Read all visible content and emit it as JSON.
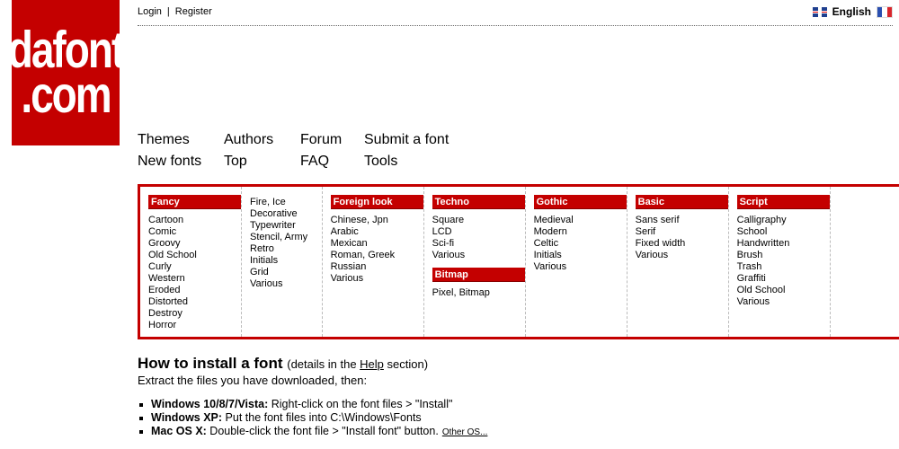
{
  "logo": {
    "line1": "dafont",
    "line2": ".com"
  },
  "topbar": {
    "login": "Login",
    "separator": "|",
    "register": "Register",
    "language": "English",
    "colors": {
      "french_blue": "#2a4fb0",
      "french_white": "#ffffff",
      "french_red": "#d8262b"
    }
  },
  "nav": {
    "col1": [
      "Themes",
      "New fonts"
    ],
    "col2": [
      "Authors",
      "Top"
    ],
    "col3": [
      "Forum",
      "FAQ"
    ],
    "col4": [
      "Submit a font",
      "Tools"
    ]
  },
  "categories": {
    "fancy": {
      "title": "Fancy",
      "items": [
        "Cartoon",
        "Comic",
        "Groovy",
        "Old School",
        "Curly",
        "Western",
        "Eroded",
        "Distorted",
        "Destroy",
        "Horror"
      ]
    },
    "fancy2": {
      "items": [
        "Fire, Ice",
        "Decorative",
        "Typewriter",
        "Stencil, Army",
        "Retro",
        "Initials",
        "Grid",
        "Various"
      ]
    },
    "foreign": {
      "title": "Foreign look",
      "items": [
        "Chinese, Jpn",
        "Arabic",
        "Mexican",
        "Roman, Greek",
        "Russian",
        "Various"
      ]
    },
    "techno": {
      "title": "Techno",
      "items": [
        "Square",
        "LCD",
        "Sci-fi",
        "Various"
      ]
    },
    "bitmap": {
      "title": "Bitmap",
      "items": [
        "Pixel, Bitmap"
      ]
    },
    "gothic": {
      "title": "Gothic",
      "items": [
        "Medieval",
        "Modern",
        "Celtic",
        "Initials",
        "Various"
      ]
    },
    "basic": {
      "title": "Basic",
      "items": [
        "Sans serif",
        "Serif",
        "Fixed width",
        "Various"
      ]
    },
    "script": {
      "title": "Script",
      "items": [
        "Calligraphy",
        "School",
        "Handwritten",
        "Brush",
        "Trash",
        "Graffiti",
        "Old School",
        "Various"
      ]
    }
  },
  "install": {
    "title": "How to install a font",
    "details_prefix": "(details in the ",
    "details_link": "Help",
    "details_suffix": " section)",
    "intro": "Extract the files you have downloaded, then:",
    "steps": [
      {
        "os": "Windows 10/8/7/Vista:",
        "text": " Right-click on the font files > \"Install\""
      },
      {
        "os": "Windows XP:",
        "text": " Put the font files into C:\\Windows\\Fonts"
      },
      {
        "os": "Mac OS X:",
        "text": " Double-click the font file > \"Install font\" button."
      }
    ],
    "other_os": "Other OS..."
  },
  "theme": {
    "brand_red": "#c40000"
  }
}
